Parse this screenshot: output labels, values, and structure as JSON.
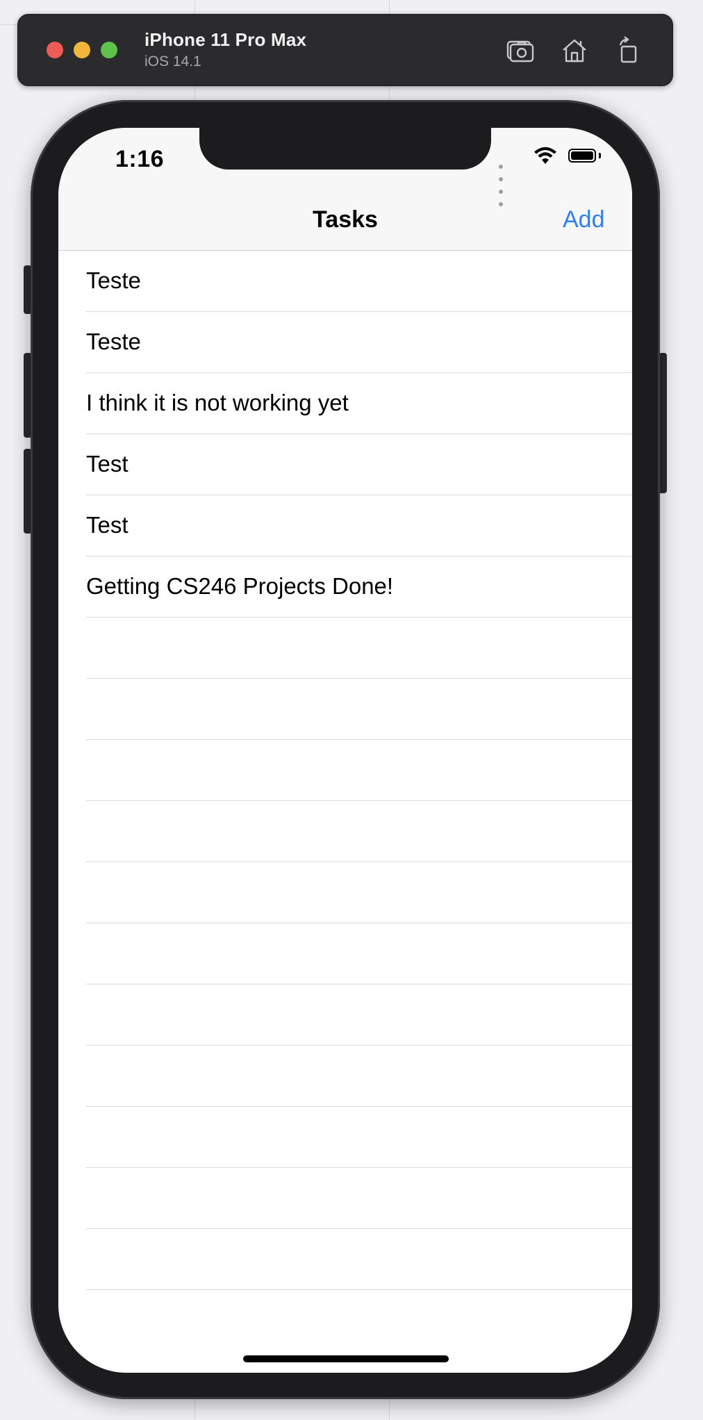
{
  "simulator": {
    "device_name": "iPhone 11 Pro Max",
    "os_version": "iOS 14.1",
    "toolbar_icons": [
      "screenshot-icon",
      "home-icon",
      "rotate-icon"
    ]
  },
  "status_bar": {
    "time": "1:16",
    "icons": [
      "signal-dots-icon",
      "wifi-icon",
      "battery-icon"
    ]
  },
  "nav_bar": {
    "title": "Tasks",
    "add_label": "Add",
    "accent_color": "#2d7ff3"
  },
  "tasks": [
    {
      "label": "Teste"
    },
    {
      "label": "Teste"
    },
    {
      "label": "I think it is not working yet"
    },
    {
      "label": "Test"
    },
    {
      "label": "Test"
    },
    {
      "label": "Getting CS246 Projects Done!"
    },
    {
      "label": ""
    },
    {
      "label": ""
    },
    {
      "label": ""
    },
    {
      "label": ""
    },
    {
      "label": ""
    },
    {
      "label": ""
    },
    {
      "label": ""
    },
    {
      "label": ""
    },
    {
      "label": ""
    },
    {
      "label": ""
    },
    {
      "label": ""
    }
  ]
}
